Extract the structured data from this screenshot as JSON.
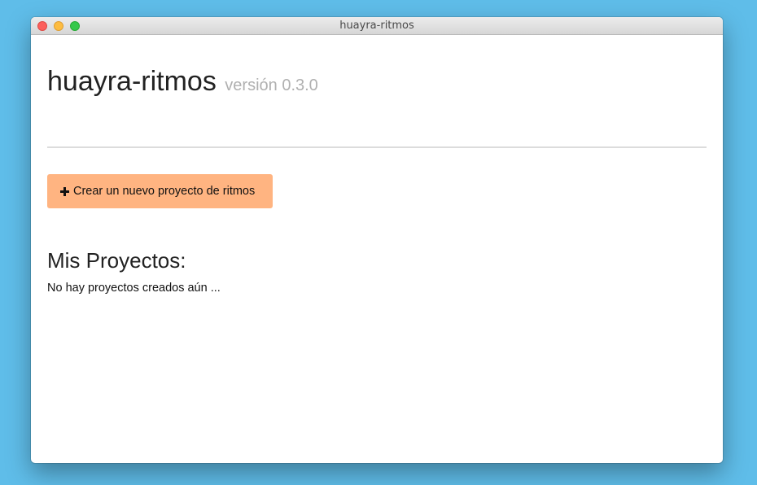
{
  "window": {
    "title": "huayra-ritmos"
  },
  "header": {
    "app_name": "huayra-ritmos",
    "version": "versión 0.3.0"
  },
  "actions": {
    "new_project_label": "Crear un nuevo proyecto de ritmos",
    "new_project_icon": "plus-icon",
    "button_color": "#ffb481"
  },
  "projects": {
    "title": "Mis Proyectos:",
    "empty_message": "No hay proyectos creados aún ..."
  }
}
